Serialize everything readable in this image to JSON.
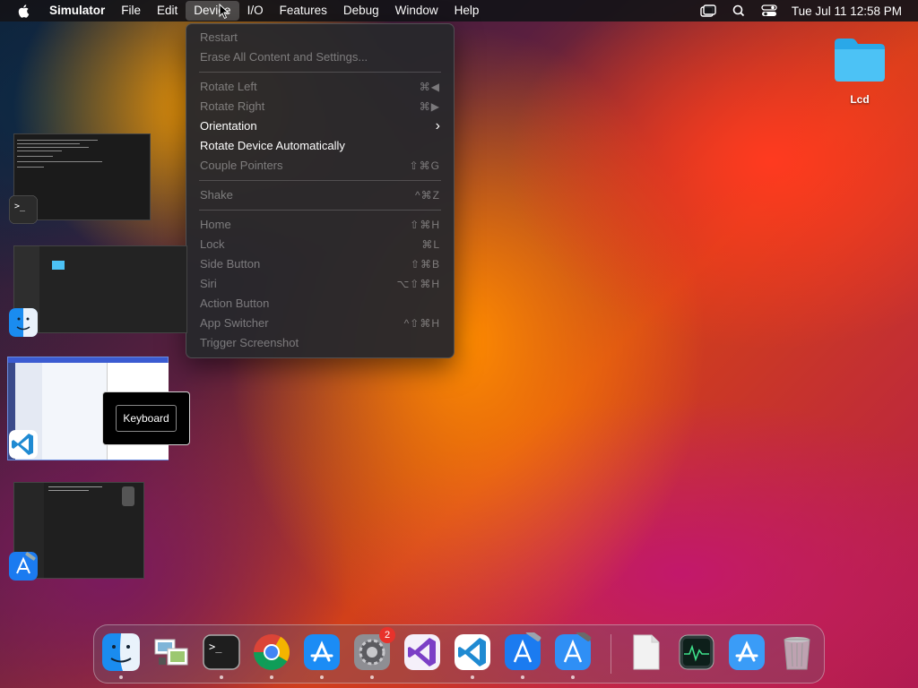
{
  "menubar": {
    "app_name": "Simulator",
    "menus": [
      "File",
      "Edit",
      "Device",
      "I/O",
      "Features",
      "Debug",
      "Window",
      "Help"
    ],
    "active_menu": "Device",
    "datetime": "Tue Jul 11  12:58 PM"
  },
  "device_menu": {
    "items": [
      {
        "label": "Restart",
        "shortcut": "",
        "enabled": false
      },
      {
        "label": "Erase All Content and Settings...",
        "shortcut": "",
        "enabled": false
      },
      {
        "label": "Rotate Left",
        "shortcut": "⌘◀",
        "enabled": false
      },
      {
        "label": "Rotate Right",
        "shortcut": "⌘▶",
        "enabled": false
      },
      {
        "label": "Orientation",
        "shortcut": "›",
        "enabled": true
      },
      {
        "label": "Rotate Device Automatically",
        "shortcut": "",
        "enabled": true
      },
      {
        "label": "Couple Pointers",
        "shortcut": "⇧⌘G",
        "enabled": false
      },
      {
        "label": "Shake",
        "shortcut": "^⌘Z",
        "enabled": false
      },
      {
        "label": "Home",
        "shortcut": "⇧⌘H",
        "enabled": false
      },
      {
        "label": "Lock",
        "shortcut": "⌘L",
        "enabled": false
      },
      {
        "label": "Side Button",
        "shortcut": "⇧⌘B",
        "enabled": false
      },
      {
        "label": "Siri",
        "shortcut": "⌥⇧⌘H",
        "enabled": false
      },
      {
        "label": "Action Button",
        "shortcut": "",
        "enabled": false
      },
      {
        "label": "App Switcher",
        "shortcut": "^⇧⌘H",
        "enabled": false
      },
      {
        "label": "Trigger Screenshot",
        "shortcut": "",
        "enabled": false
      }
    ]
  },
  "desktop": {
    "folder_label": "Lcd"
  },
  "tooltip": {
    "label": "Keyboard"
  },
  "dock": {
    "system_preferences_badge": "2",
    "apps": [
      "finder",
      "preview",
      "terminal",
      "chrome",
      "app-store",
      "system-preferences",
      "visual-studio",
      "vscode",
      "xcode",
      "xcode-beta",
      "file",
      "activity-monitor",
      "app-store-beta",
      "trash"
    ]
  }
}
